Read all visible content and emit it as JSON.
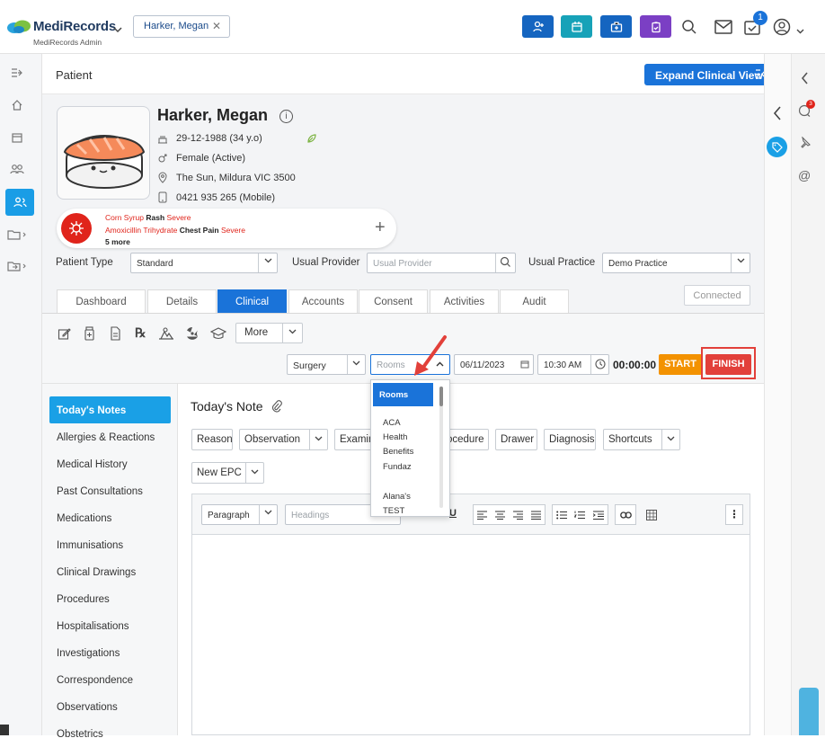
{
  "app": {
    "name": "MediRecords",
    "subtitle": "MediRecords Admin"
  },
  "open_patient_tab": "Harker, Megan",
  "notification_count": "1",
  "chat_badge": "3",
  "header": {
    "section": "Patient",
    "expand_label": "Expand Clinical View"
  },
  "patient": {
    "name": "Harker, Megan",
    "dob": "29-12-1988 (34 y.o)",
    "gender": "Female (Active)",
    "address": "The Sun, Mildura VIC 3500",
    "phone": "0421 935 265 (Mobile)"
  },
  "allergies": [
    {
      "substance": "Corn Syrup",
      "reaction": "Rash",
      "severity": "Severe"
    },
    {
      "substance": "Amoxicillin Trihydrate",
      "reaction": "Chest Pain",
      "severity": "Severe"
    }
  ],
  "allergies_more": "5 more",
  "fields": {
    "patient_type_label": "Patient Type",
    "patient_type_value": "Standard",
    "usual_provider_label": "Usual Provider",
    "usual_provider_placeholder": "Usual Provider",
    "usual_practice_label": "Usual Practice",
    "usual_practice_value": "Demo Practice",
    "connected": "Connected"
  },
  "tabs": [
    "Dashboard",
    "Details",
    "Clinical",
    "Accounts",
    "Consent",
    "Activities",
    "Audit"
  ],
  "toolbar": {
    "more": "More"
  },
  "encounter": {
    "type": "Surgery",
    "rooms_placeholder": "Rooms",
    "date": "06/11/2023",
    "time": "10:30 AM",
    "timer": "00:00:00",
    "start": "START",
    "finish": "FINISH"
  },
  "rooms_dropdown": {
    "selected": "Rooms",
    "options": [
      "ACA",
      "Health",
      "Benefits",
      "Fundaz",
      "",
      "Alana's",
      "TEST"
    ]
  },
  "nav": [
    "Today's Notes",
    "Allergies & Reactions",
    "Medical History",
    "Past Consultations",
    "Medications",
    "Immunisations",
    "Clinical Drawings",
    "Procedures",
    "Hospitalisations",
    "Investigations",
    "Correspondence",
    "Observations",
    "Obstetrics"
  ],
  "note": {
    "title": "Today's Note",
    "chips": [
      "Reason",
      "Observation",
      "Examin",
      "ocedure",
      "Drawer",
      "Diagnosis",
      "Shortcuts",
      "New EPC"
    ],
    "editor_paragraph": "Paragraph",
    "editor_headings": "Headings"
  },
  "colors": {
    "primary": "#1a73d9",
    "start": "#f39200",
    "finish": "#e2403a",
    "nav_active": "#1aa0e6",
    "severe": "#e0241b"
  }
}
